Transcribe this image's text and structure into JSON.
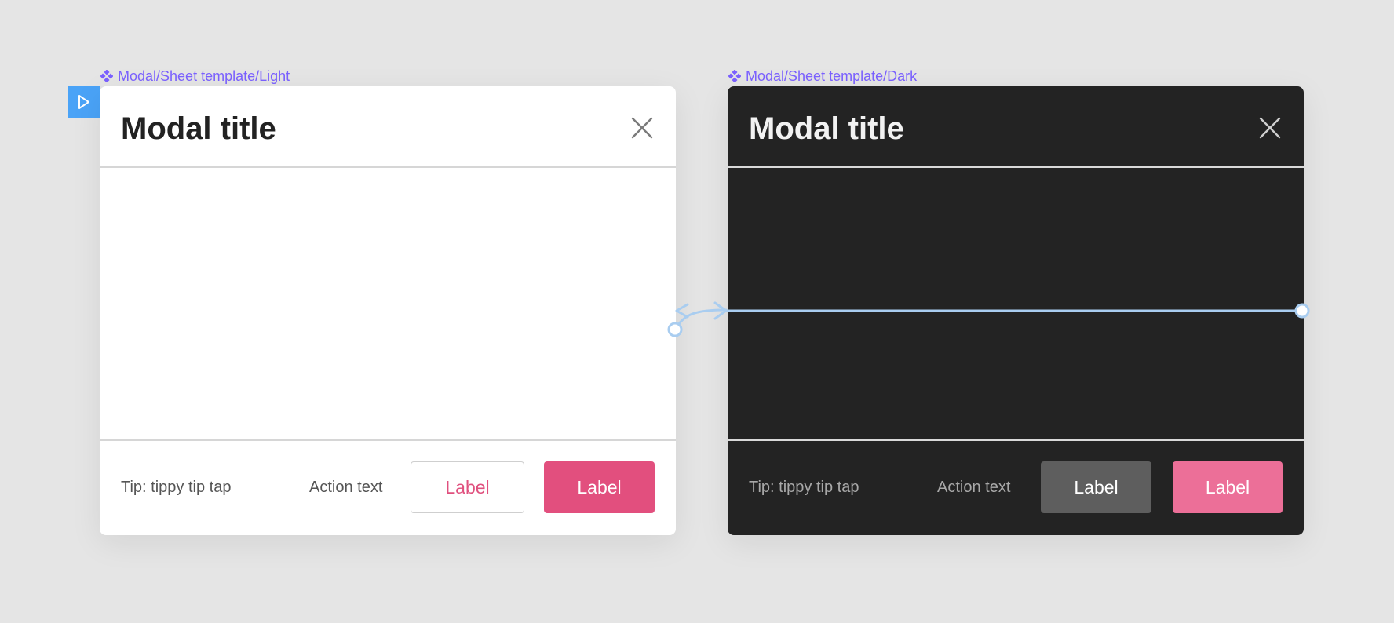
{
  "canvas": {
    "background": "#e5e5e5",
    "accent_component": "#7b61ff",
    "prototype_color": "#4aa3f7"
  },
  "frames": [
    {
      "label": "Modal/Sheet template/Light",
      "title": "Modal title",
      "tip": "Tip: tippy tip tap",
      "action_text": "Action text",
      "secondary_label": "Label",
      "primary_label": "Label",
      "theme": "light",
      "primary_color": "#e24f7e"
    },
    {
      "label": "Modal/Sheet template/Dark",
      "title": "Modal title",
      "tip": "Tip: tippy tip tap",
      "action_text": "Action text",
      "secondary_label": "Label",
      "primary_label": "Label",
      "theme": "dark",
      "primary_color": "#ec6f98"
    }
  ],
  "icons": {
    "component": "component-diamond-icon",
    "close": "close-icon",
    "play": "play-icon"
  }
}
